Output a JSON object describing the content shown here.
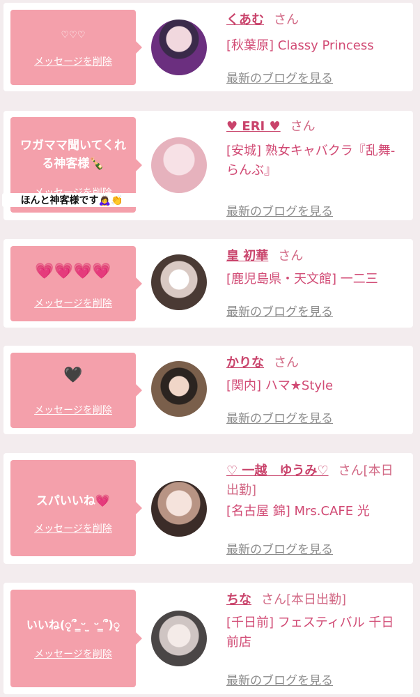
{
  "delete_label": "メッセージを削除",
  "san_label": "さん",
  "blog_label": "最新のブログを見る",
  "items": [
    {
      "message": "♡♡♡",
      "name": "くあむ",
      "san": "さん",
      "shop": "[秋葉原] Classy Princess"
    },
    {
      "message": "ワガママ聞いてくれる神客様🍾",
      "overlay": "ほんと神客様です🙇‍♀️👏",
      "name": "♥ ERI ♥",
      "san": "さん",
      "shop": "[安城] 熟女キャバクラ『乱舞-らんぶ』"
    },
    {
      "message": "💗💗💗💗",
      "name": "皇 初華",
      "san": "さん",
      "shop": "[鹿児島県・天文館] 一二三"
    },
    {
      "message": "🖤",
      "name": "かりな",
      "san": "さん",
      "shop": "[関内] ハマ★Style"
    },
    {
      "message": "スパいいね💗",
      "name": "♡ 一越　ゆうみ♡",
      "san": "さん[本日出勤]",
      "shop": "[名古屋 錦] Mrs.CAFE 光"
    },
    {
      "message": "いいね(ृ՞ ̳ᵕ ̫ ᵕ ̳՞)ृ",
      "name": "ちな",
      "san": "さん[本日出勤]",
      "shop": "[千日前] フェスティバル 千日前店"
    }
  ],
  "colors": {
    "bubble": "#f4a0ab",
    "accent": "#c9436b",
    "background": "#f3ecee"
  }
}
